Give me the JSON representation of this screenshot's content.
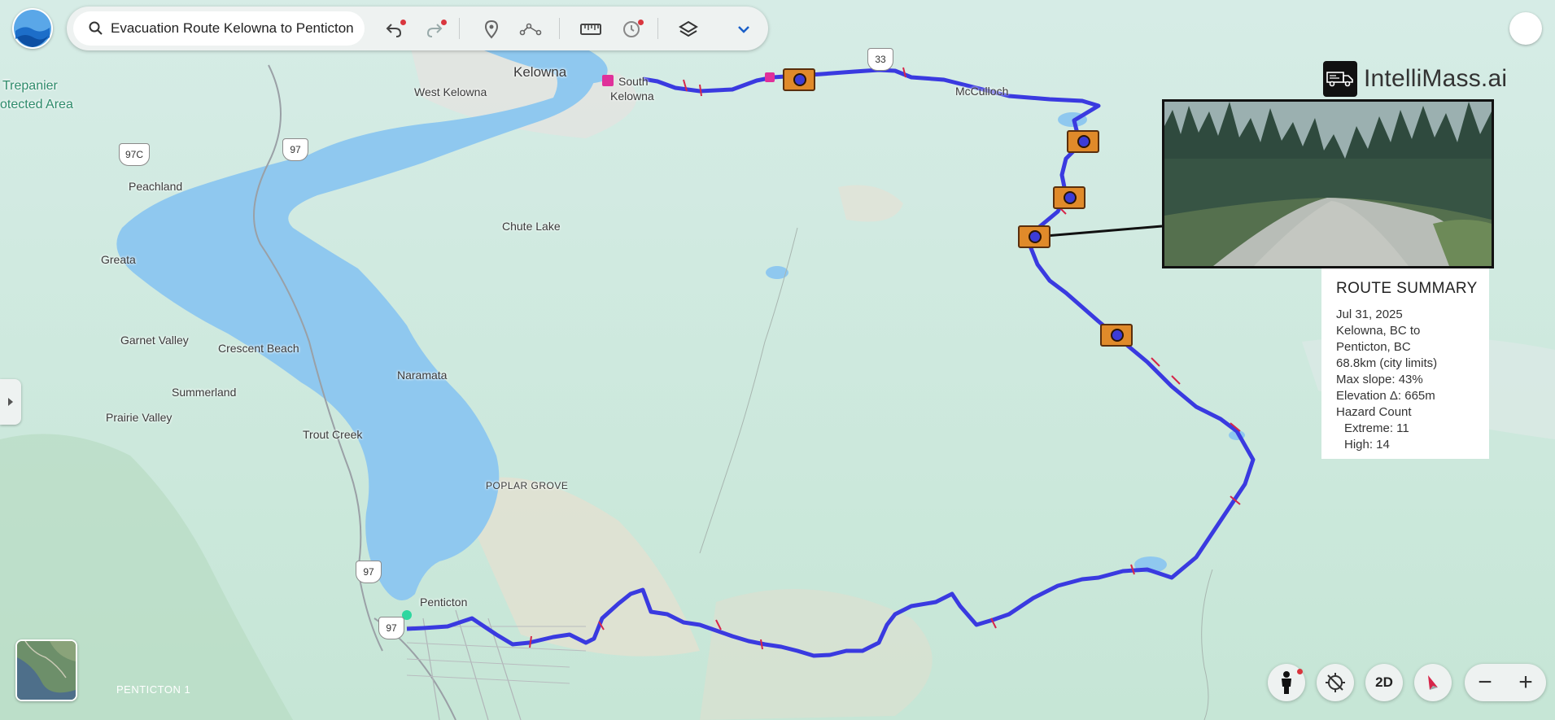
{
  "search": {
    "query": "Evacuation Route Kelowna to Penticton"
  },
  "icons": {
    "app_logo": "globe-logo-icon",
    "search": "search-icon",
    "undo": "undo-icon",
    "redo": "redo-icon",
    "placemark": "placemark-icon",
    "path": "path-icon",
    "measure": "ruler-icon",
    "historical": "history-icon",
    "layers": "layers-icon",
    "more": "chevron-down-icon",
    "pegman": "pegman-icon",
    "location": "my-location-icon",
    "compass": "compass-icon",
    "zoom_out": "minus-icon",
    "zoom_in": "plus-icon"
  },
  "controls": {
    "view_mode": "2D",
    "zoom_out": "−",
    "zoom_in": "+"
  },
  "map_labels": {
    "kelowna": "Kelowna",
    "west_kelowna": "West Kelowna",
    "south_kelowna_1": "South",
    "south_kelowna_2": "Kelowna",
    "mcculloch": "McCulloch",
    "trepanier_1": "Trepanier",
    "trepanier_2": "otected Area",
    "peachland": "Peachland",
    "greata": "Greata",
    "chute_lake": "Chute Lake",
    "garnet_valley": "Garnet Valley",
    "crescent_beach": "Crescent Beach",
    "naramata": "Naramata",
    "summerland": "Summerland",
    "prairie_valley": "Prairie Valley",
    "trout_creek": "Trout Creek",
    "poplar_grove": "POPLAR GROVE",
    "penticton": "Penticton",
    "penticton_1": "PENTICTON 1"
  },
  "highway_shields": {
    "h97c": "97C",
    "h97_north": "97",
    "h97_mid": "97",
    "h97_south": "97",
    "h33": "33"
  },
  "brand": {
    "name": "IntelliMass.ai"
  },
  "route_summary": {
    "title": "ROUTE SUMMARY",
    "date": "Jul 31, 2025",
    "from": "Kelowna, BC to",
    "to": "Penticton, BC",
    "distance": "68.8km (city limits)",
    "max_slope": "Max slope: 43%",
    "elevation": "Elevation Δ: 665m",
    "hazard_title": "Hazard Count",
    "hazard_extreme": "Extreme: 11",
    "hazard_high": "High: 14"
  },
  "colors": {
    "route": "#3a3ae0",
    "lake": "#8fc8ef",
    "hazard_extreme": "#d6264a",
    "start_marker": "#e0309a",
    "camera_marker": "#e08a2a",
    "land": "#cfe8de"
  }
}
